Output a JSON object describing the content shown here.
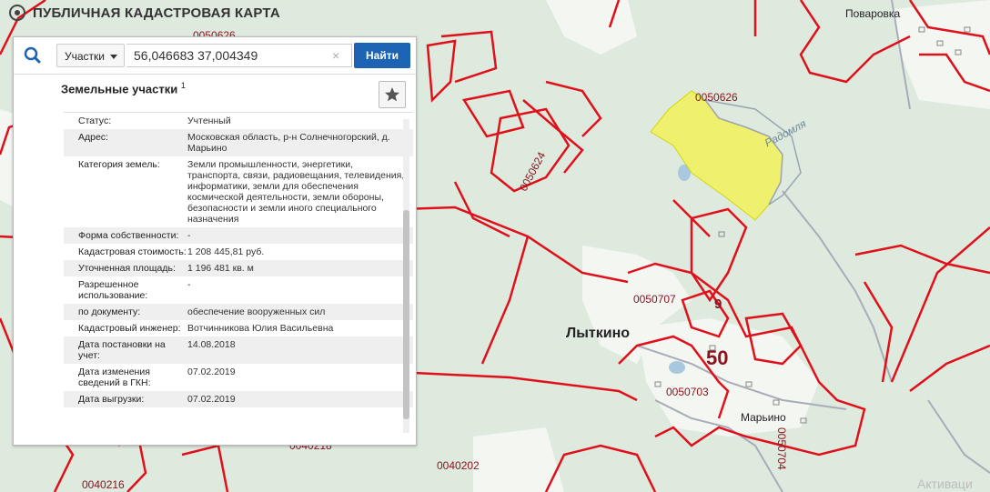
{
  "app": {
    "title": "ПУБЛИЧНАЯ КАДАСТРОВАЯ КАРТА"
  },
  "search": {
    "type_label": "Участки",
    "query": "56,046683 37,004349",
    "clear_symbol": "×",
    "find_label": "Найти"
  },
  "panel": {
    "section_title": "Земельные участки",
    "section_count": "1",
    "rows": [
      {
        "label": "Статус:",
        "value": "Учтенный"
      },
      {
        "label": "Адрес:",
        "value": "Московская область, р-н Солнечногорский, д. Марьино"
      },
      {
        "label": "Категория земель:",
        "value": "Земли промышленности, энергетики, транспорта, связи, радиовещания, телевидения, информатики, земли для обеспечения космической деятельности, земли обороны, безопасности и земли иного специального назначения"
      },
      {
        "label": "Форма собственности:",
        "value": "-"
      },
      {
        "label": "Кадастровая стоимость:",
        "value": "1 208 445,81 руб."
      },
      {
        "label": "Уточненная площадь:",
        "value": "1 196 481 кв. м"
      },
      {
        "label": "Разрешенное использование:",
        "value": "-"
      },
      {
        "label": "по документу:",
        "value": "обеспечение вооруженных сил"
      },
      {
        "label": "Кадастровый инженер:",
        "value": "Вотчинникова Юлия Васильевна"
      },
      {
        "label": "Дата постановки на учет:",
        "value": "14.08.2018"
      },
      {
        "label": "Дата изменения сведений в ГКН:",
        "value": "07.02.2019"
      },
      {
        "label": "Дата выгрузки:",
        "value": "07.02.2019"
      }
    ]
  },
  "map": {
    "labels": {
      "povarovka": "Поваровка",
      "lytkino": "Лыткино",
      "marino": "Марьино",
      "radomlya": "Радомля",
      "q0050626": "0050626",
      "q0050624": "0050624",
      "q0050707": "0050707",
      "q0050703": "0050703",
      "q0050704": "0050704",
      "q0040202": "0040202",
      "q0040216": "0040216",
      "q0050626_left": "0050626",
      "q0040218": "0040218",
      "n50": "50",
      "n9": "9",
      "watermark": "Активаци"
    }
  },
  "colors": {
    "boundary": "#e0101a",
    "selected_parcel": "#f2f25a",
    "accent": "#1c63b4"
  }
}
